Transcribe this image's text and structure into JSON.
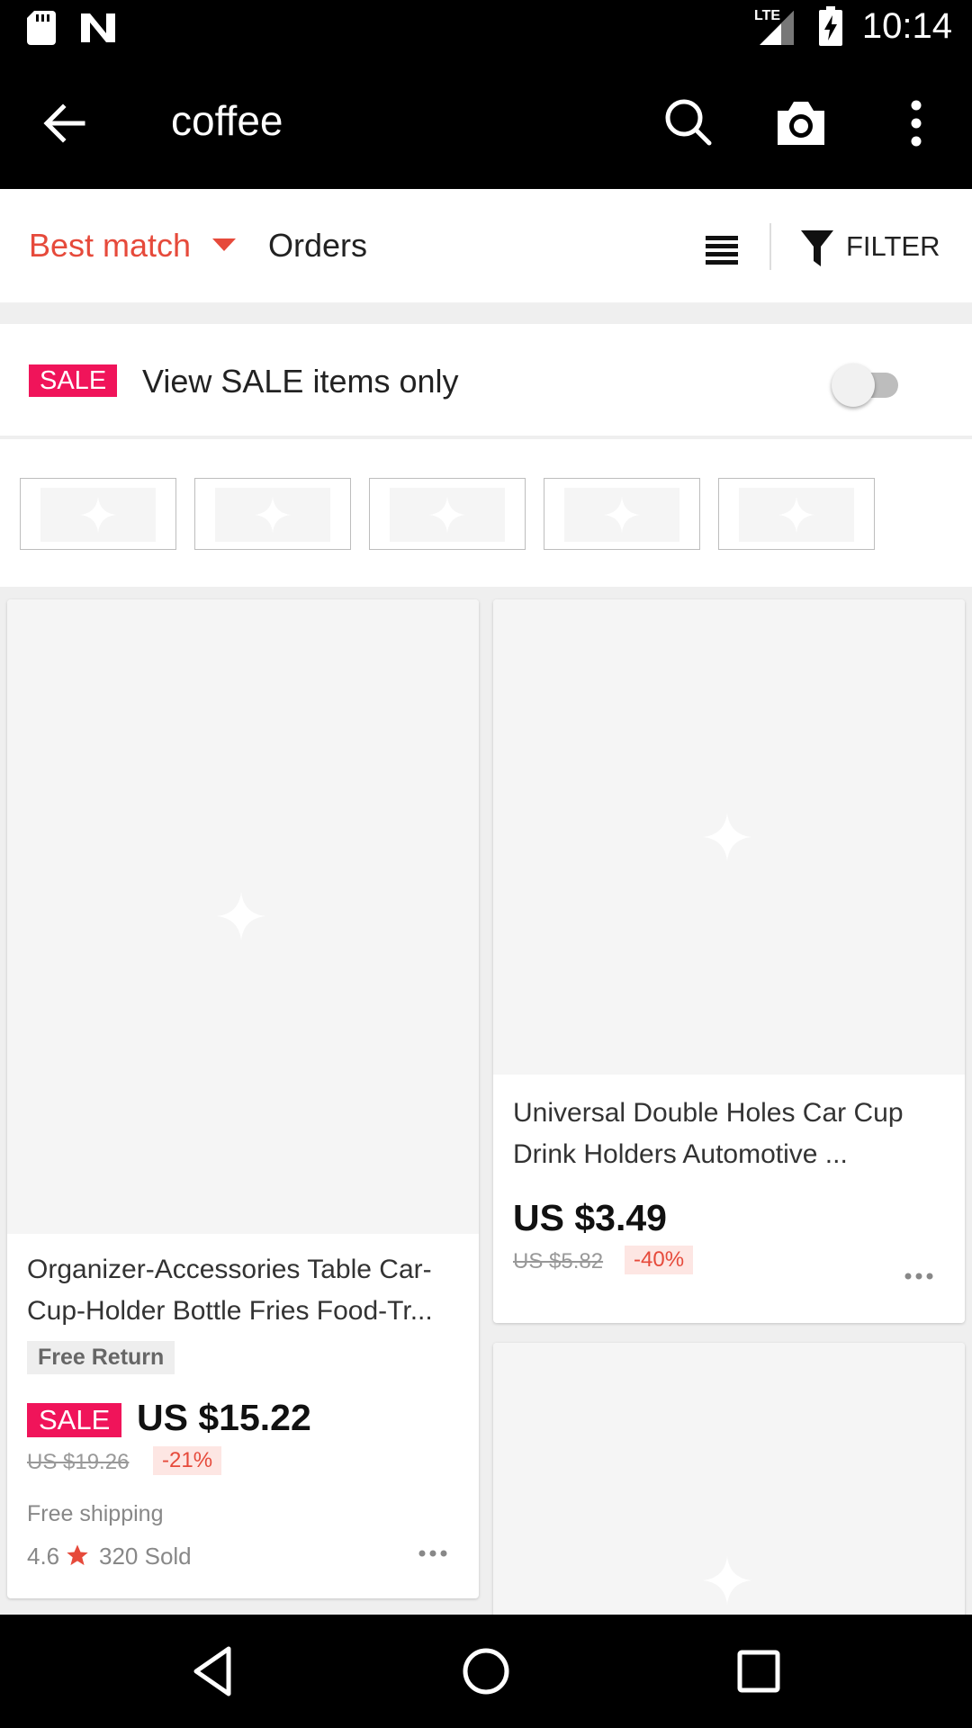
{
  "status_bar": {
    "time": "10:14",
    "network": "LTE",
    "icons": [
      "sd-card-icon",
      "notification-n-icon",
      "signal-icon",
      "battery-charging-icon"
    ]
  },
  "toolbar": {
    "title": "coffee",
    "icons": [
      "back-arrow-icon",
      "search-icon",
      "camera-icon",
      "more-vert-icon"
    ]
  },
  "sort_bar": {
    "best_match": "Best match",
    "orders": "Orders",
    "filter": "FILTER",
    "active_color": "#e64a3b"
  },
  "sale_row": {
    "badge": "SALE",
    "text": "View SALE items only",
    "toggle_on": false
  },
  "thumbnails": {
    "count": 5
  },
  "products": [
    {
      "title": "Organizer-Accessories Table Car-Cup-Holder Bottle Fries Food-Tr...",
      "free_return": "Free Return",
      "sale_badge": "SALE",
      "price": "US $15.22",
      "old_price": "US $19.26",
      "discount": "-21%",
      "shipping": "Free shipping",
      "rating": "4.6",
      "sold": "320 Sold"
    },
    {
      "title": "Universal Double Holes Car Cup Drink Holders Automotive ...",
      "price": "US $3.49",
      "old_price": "US $5.82",
      "discount": "-40%"
    }
  ],
  "colors": {
    "sale_pink": "#f0145a",
    "accent_red": "#e64a3b"
  }
}
